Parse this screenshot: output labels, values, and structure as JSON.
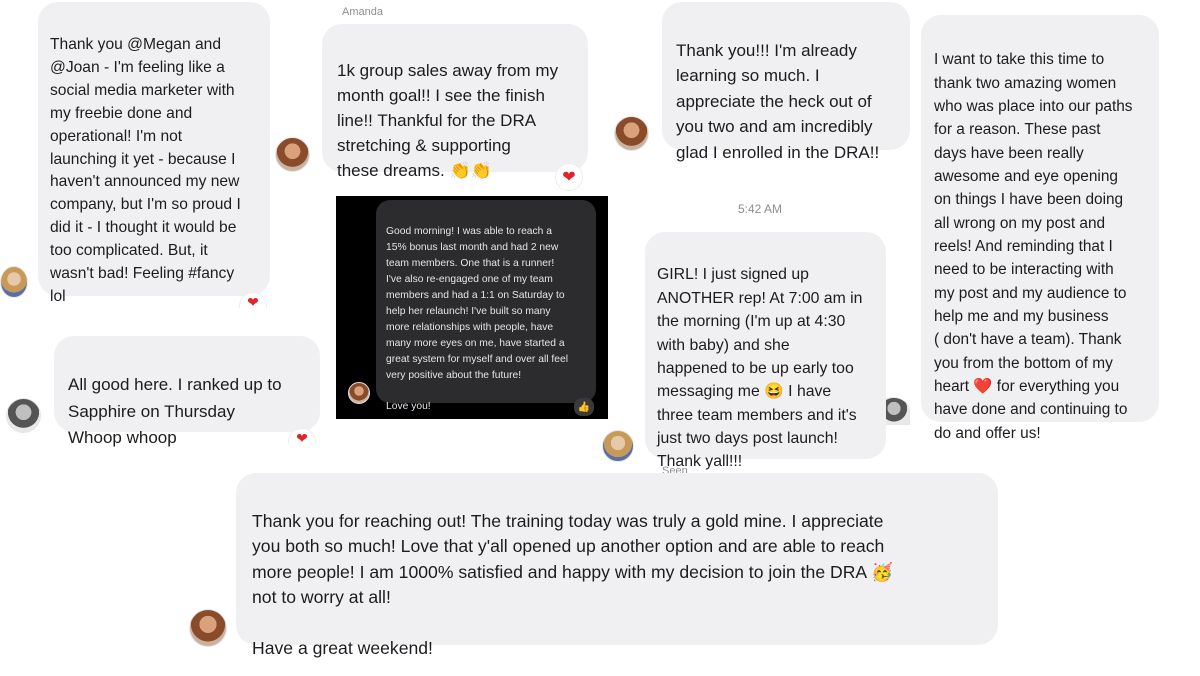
{
  "messages": {
    "m1": {
      "text": "Thank you @Megan and\n@Joan - I'm feeling like a\nsocial media marketer with\nmy freebie done and\noperational!  I'm not\nlaunching it yet - because I\nhaven't announced my new\ncompany, but I'm so proud I\ndid it - I thought it would be\ntoo complicated.  But, it\nwasn't bad!  Feeling #fancy\nlol"
    },
    "m2": {
      "sender": "Amanda",
      "text": "1k group sales away from my\nmonth goal!! I see the finish\nline!! Thankful for the DRA\nstretching & supporting\nthese dreams. 👏👏"
    },
    "m3": {
      "text": "Thank you!!! I'm already\nlearning so much. I\nappreciate the heck out of\nyou two and am incredibly\nglad I enrolled in the DRA!!"
    },
    "m4": {
      "text": "I want to take this time to\nthank two amazing women\nwho was place into our paths\nfor a reason. These past\ndays have been really\nawesome and eye opening\non things I have been doing\nall wrong on my post and\nreels! And reminding that I\nneed to be interacting with\nmy post and my audience to\nhelp me and my business\n( don't have a team). Thank\nyou from the bottom of my\nheart ❤️ for everything you\nhave done and continuing to\ndo and offer us!"
    },
    "m5": {
      "text": "All good here. I ranked up to\nSapphire on Thursday\nWhoop whoop"
    },
    "m6": {
      "text": "Good morning! I was able to reach a\n15% bonus last month and had 2 new\nteam members. One that is a runner!\nI've also re-engaged one of my team\nmembers and had a 1:1 on Saturday to\nhelp her relaunch! I've built so many\nmore relationships with people, have\nmany more eyes on me, have started a\ngreat system for myself and over all feel\nvery positive about the future!\n\nLove you!"
    },
    "m7": {
      "timestamp": "5:42 AM",
      "text": "GIRL!  I just signed up\nANOTHER rep!  At 7:00 am in\nthe morning (I'm up at 4:30\nwith baby) and she\nhappened to be up early too\nmessaging me 😆  I have\nthree team members and it's\njust two days post launch!\nThank yall!!!"
    },
    "m8": {
      "status": "Seen",
      "text": "Thank you for reaching out! The training today was truly a gold mine. I appreciate\nyou both so much! Love that y'all opened up another option and are able to reach\nmore people! I am 1000% satisfied and happy with my decision to join the DRA 🥳\nnot to worry at all!\n\nHave a great weekend!"
    }
  },
  "reactions": {
    "heart": "❤",
    "thumb": "👍"
  },
  "colors": {
    "bubble": "#f0f0f3",
    "heart": "#e0242b",
    "dark_bubble": "#2c2c2e"
  }
}
